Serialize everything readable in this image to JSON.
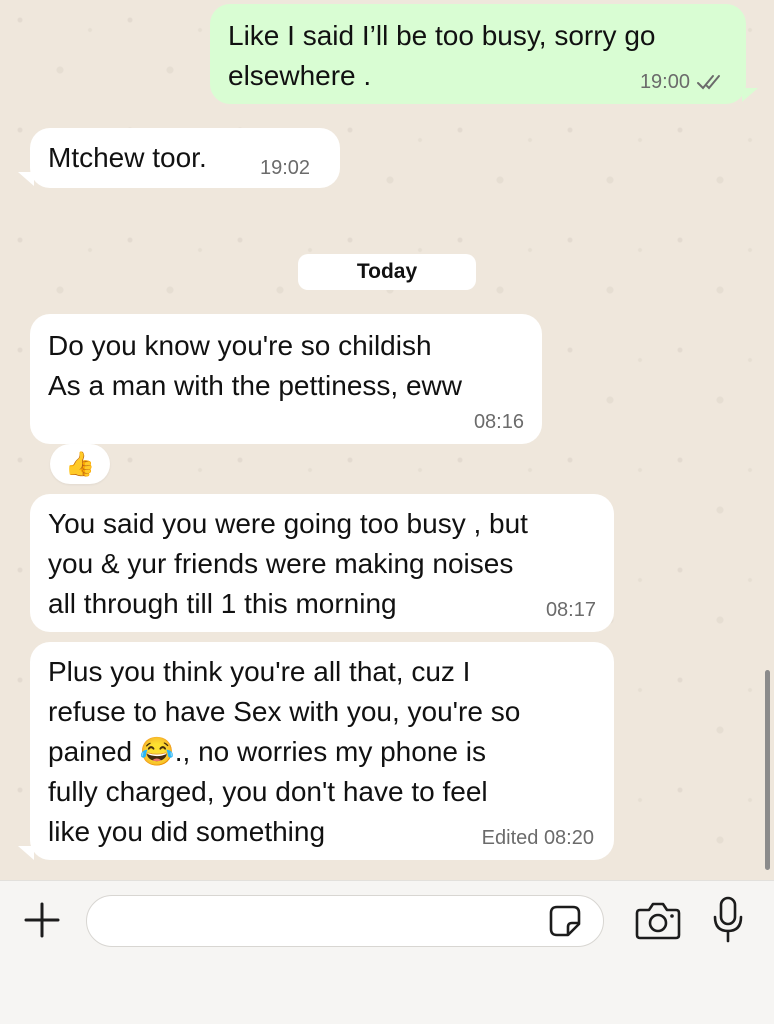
{
  "messages": [
    {
      "direction": "outgoing",
      "lines": [
        "Like I said I’ll be too busy, sorry go",
        "elsewhere ."
      ],
      "time": "19:00",
      "status_icon": "double-check-icon"
    },
    {
      "direction": "incoming",
      "lines": [
        "Mtchew toor."
      ],
      "time": "19:02"
    },
    {
      "direction": "incoming",
      "lines": [
        "Do you know you're so childish",
        "As a man with the pettiness, eww"
      ],
      "time": "08:16",
      "reaction": "👍"
    },
    {
      "direction": "incoming",
      "lines": [
        "You said you were going too busy , but",
        "you & yur friends were making noises",
        "all through till 1 this morning"
      ],
      "time": "08:17"
    },
    {
      "direction": "incoming",
      "lines": [
        "Plus you think you're all that, cuz I",
        "refuse to have Sex with you, you're so",
        "pained 😂., no worries my phone is",
        "fully charged, you don't have to feel",
        "like you did something"
      ],
      "time": "Edited 08:20"
    }
  ],
  "date_separator": "Today",
  "composer": {
    "value": "",
    "placeholder": "",
    "icons": [
      "plus-icon",
      "sticker-icon",
      "camera-icon",
      "microphone-icon"
    ]
  },
  "colors": {
    "outgoing_bubble": "#d9fdd3",
    "incoming_bubble": "#ffffff",
    "chat_background": "#efe7dc",
    "read_ticks": "#6b6b6b"
  }
}
